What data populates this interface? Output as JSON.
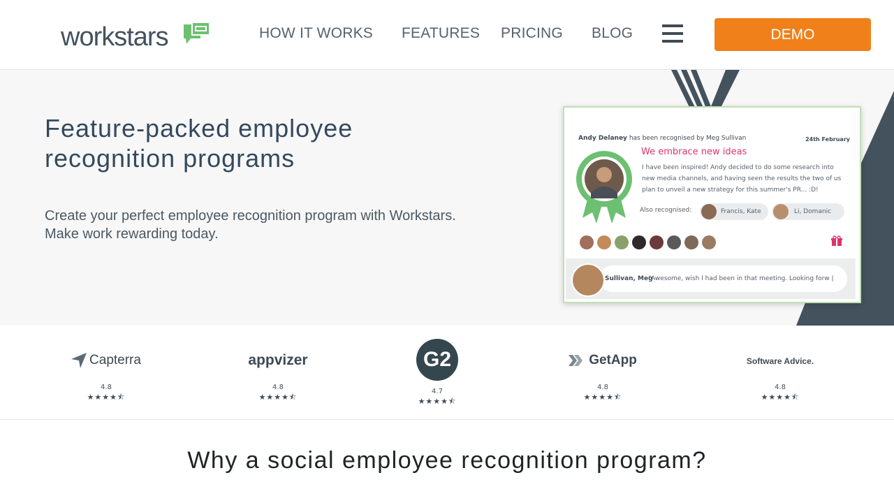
{
  "header": {
    "logo_text": "workstars",
    "nav": [
      "HOW IT WORKS",
      "FEATURES",
      "PRICING",
      "BLOG"
    ],
    "demo_label": "DEMO"
  },
  "hero": {
    "title": "Feature-packed employee recognition programs",
    "subtitle": "Create your perfect employee recognition program with Workstars. Make work rewarding today."
  },
  "card": {
    "recipient": "Andy Delaney",
    "from_text": "has been recognised by Meg Sullivan",
    "date": "24th February",
    "headline": "We embrace new ideas",
    "body": "I have been inspired! Andy decided to do some research into new media channels, and having seen the results the two of us plan to unveil a new strategy for this summer's PR... :D!",
    "also_label": "Also recognised:",
    "also": [
      "Francis, Kate",
      "Li, Domanic"
    ],
    "comment_name": "Sullivan, Meg",
    "comment_text": "\"Awesome, wish I had been in that meeting. Looking forw |"
  },
  "ratings": [
    {
      "brand": "Capterra",
      "score": "4.8",
      "stars": "★★★★⯪"
    },
    {
      "brand": "appvizer",
      "score": "4.8",
      "stars": "★★★★⯪"
    },
    {
      "brand": "G2",
      "score": "4.7",
      "stars": "★★★★⯪"
    },
    {
      "brand": "GetApp",
      "score": "4.8",
      "stars": "★★★★⯪"
    },
    {
      "brand": "Software Advice.",
      "score": "4.8",
      "stars": "★★★★⯪"
    }
  ],
  "section": {
    "title": "Why a social employee recognition program?"
  },
  "colors": {
    "accent": "#f08019",
    "logo_green": "#6cc071",
    "pink": "#e0336c",
    "dark": "#3f4b55"
  },
  "icons": [
    "chat-bubble-icon",
    "hamburger-menu-icon",
    "award-badge-icon",
    "gift-icon"
  ]
}
